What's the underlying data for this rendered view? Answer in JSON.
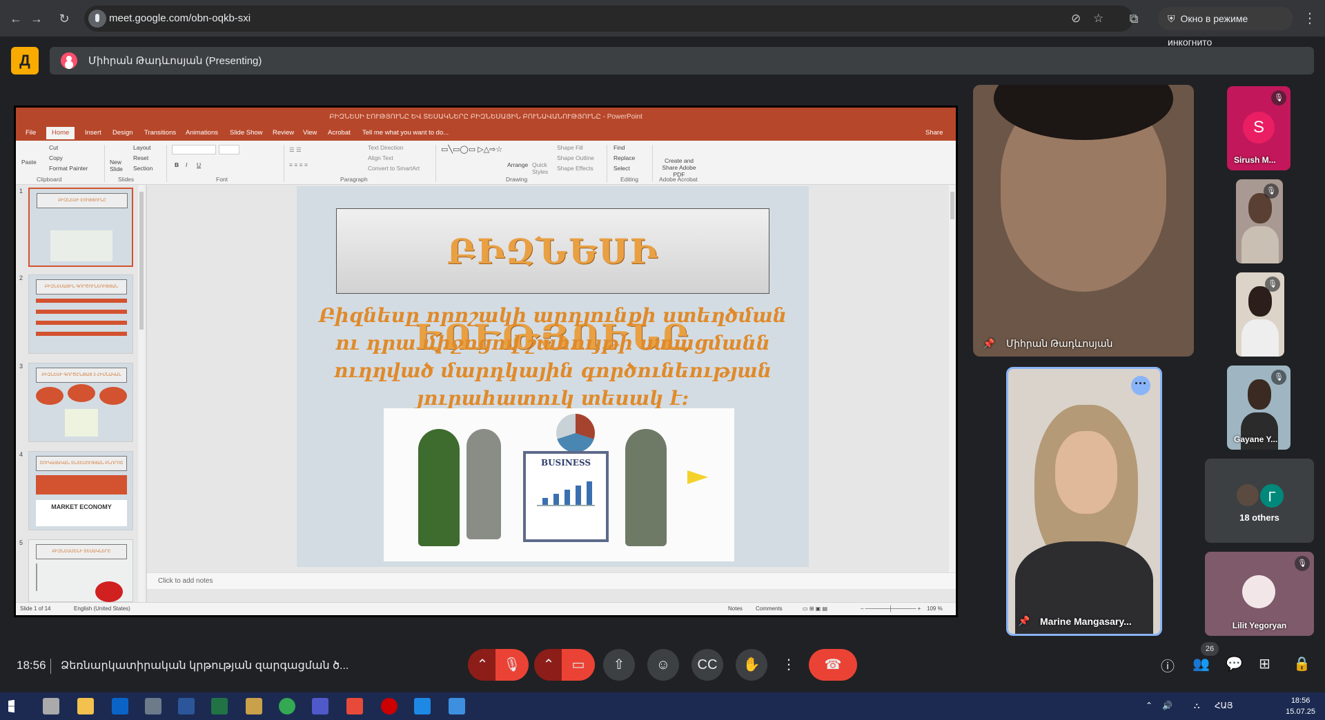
{
  "browser": {
    "url": "meet.google.com/obn-oqkb-sxi",
    "incognito_label": "Окно в режиме инкогнито"
  },
  "meet": {
    "presenter_label": "Միհրան Թադևոսյան (Presenting)",
    "clock": "18:56",
    "meeting_name": "Ձեռնարկատիրական կրթության զարգացման ծ...",
    "participant_count": "26"
  },
  "ppt": {
    "window_title": "ԲԻԶՆԵՍԻ ԷՈՒԹՅՈՒՆԸ ԵՎ ՏԵՍԱԿՆԵՐԸ ԲԻԶՆԵՍԱՅԻՆ ԲՈՒՆԱՎԱՆՈՒԹՅՈՒՆԸ - PowerPoint",
    "tabs": [
      "File",
      "Home",
      "Insert",
      "Design",
      "Transitions",
      "Animations",
      "Slide Show",
      "Review",
      "View",
      "Acrobat",
      "Tell me what you want to do..."
    ],
    "share_label": "Share",
    "ribbon": {
      "paste": "Paste",
      "cut": "Cut",
      "copy": "Copy",
      "format_painter": "Format Painter",
      "clipboard": "Clipboard",
      "new_slide": "New Slide",
      "layout": "Layout",
      "reset": "Reset",
      "section": "Section",
      "slides": "Slides",
      "font": "Font",
      "paragraph": "Paragraph",
      "text_direction": "Text Direction",
      "align_text": "Align Text",
      "convert_smartart": "Convert to SmartArt",
      "arrange": "Arrange",
      "quick_styles": "Quick Styles",
      "shape_fill": "Shape Fill",
      "shape_outline": "Shape Outline",
      "shape_effects": "Shape Effects",
      "drawing": "Drawing",
      "find": "Find",
      "replace": "Replace",
      "select": "Select",
      "editing": "Editing",
      "create_share_pdf": "Create and Share Adobe PDF",
      "adobe_acrobat": "Adobe Acrobat"
    },
    "thumbnails": [
      {
        "num": "1",
        "title": "ԲԻԶՆԵՍԻ ԷՈՒԹՅՈՒՆԸ"
      },
      {
        "num": "2",
        "title": "ԲԻԶՆԵՍԱՅԻՆ ԳՈՐԾՈՒՆԵՈՒԹՅԱՆ ՏԵՍԱԿՆԵՐԸ"
      },
      {
        "num": "3",
        "title": "ԲԻԶՆԵՍԻ ԳՈՐԾԸՆԹԱՑ 3 ՀԻՄՆԱԿԱՆ ՓՈՒԼԵՐ"
      },
      {
        "num": "4",
        "title": "ՇՈՒԿԱՅԱԿԱՆ ՏՆՏԵՍՈՒԹՅԱՆ ԲՆՈՐՈՇ ԳԾԵՐԸ"
      },
      {
        "num": "5",
        "title": "ԲԻԶՆԵՍՄԵՆԻ ՏԵՍԱԿՆԵՐԸ"
      }
    ],
    "thumb4_label": "MARKET ECONOMY",
    "slide_title": "ԲԻԶՆԵՍԻ ԷՈՒԹՅՈՒՆԸ",
    "slide_text": "Բիզնեսը որոշակի արդյունքի ստեղծման ու դրա միջոցով շահույթի ստացմանն ուղղված մարդկային գործունեության յուրահատուկ տեսակ է:",
    "image_label": "BUSINESS",
    "notes_placeholder": "Click to add notes",
    "status": {
      "slide_of": "Slide 1 of 14",
      "language": "English (United States)",
      "notes": "Notes",
      "comments": "Comments",
      "zoom": "109 %"
    }
  },
  "participants": {
    "main_speaker": "Միհրան Թադևոսյան",
    "marine": "Marine Mangasary...",
    "sirush": "Sirush M...",
    "sirush_initial": "S",
    "gayane": "Gayane Y...",
    "others_initial": "Г",
    "others_label": "18 others",
    "lilit": "Lilit Yegoryan"
  },
  "taskbar": {
    "lang": "ՀԱՅ",
    "time": "18:56",
    "date": "15.07.25"
  },
  "colors": {
    "ppt_accent": "#b7472a",
    "leave_red": "#ea4335",
    "meet_yellow": "#f9ab00"
  }
}
